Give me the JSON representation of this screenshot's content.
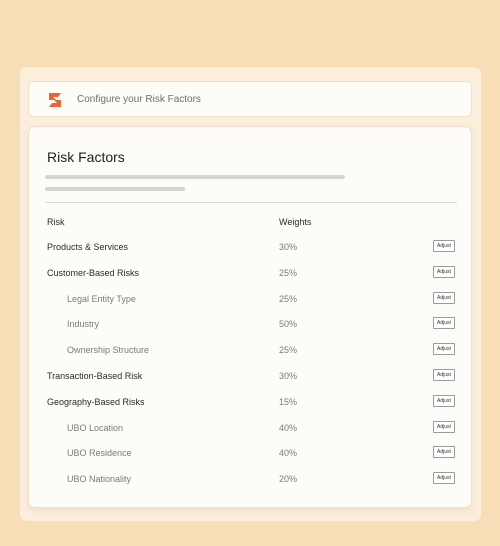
{
  "header": {
    "title": "Configure your Risk Factors",
    "logo_icon": "brand-logo-icon",
    "logo_color": "#e8633a"
  },
  "card": {
    "title": "Risk Factors",
    "columns": {
      "risk": "Risk",
      "weights": "Weights"
    },
    "rows": [
      {
        "name": "Products & Services",
        "weight": "30%",
        "level": "parent",
        "action": "Adjust"
      },
      {
        "name": "Customer-Based Risks",
        "weight": "25%",
        "level": "parent",
        "action": "Adjust"
      },
      {
        "name": "Legal Entity Type",
        "weight": "25%",
        "level": "child",
        "action": "Adjust"
      },
      {
        "name": "Industry",
        "weight": "50%",
        "level": "child",
        "action": "Adjust"
      },
      {
        "name": "Ownership Structure",
        "weight": "25%",
        "level": "child",
        "action": "Adjust"
      },
      {
        "name": "Transaction-Based Risk",
        "weight": "30%",
        "level": "parent",
        "action": "Adjust"
      },
      {
        "name": "Geography-Based Risks",
        "weight": "15%",
        "level": "parent",
        "action": "Adjust"
      },
      {
        "name": "UBO Location",
        "weight": "40%",
        "level": "child",
        "action": "Adjust"
      },
      {
        "name": "UBO Residence",
        "weight": "40%",
        "level": "child",
        "action": "Adjust"
      },
      {
        "name": "UBO Nationality",
        "weight": "20%",
        "level": "child",
        "action": "Adjust"
      }
    ]
  },
  "colors": {
    "background": "#f8deb6",
    "panel": "#fbeedd",
    "card": "#fefcf8",
    "accent": "#e8633a"
  }
}
